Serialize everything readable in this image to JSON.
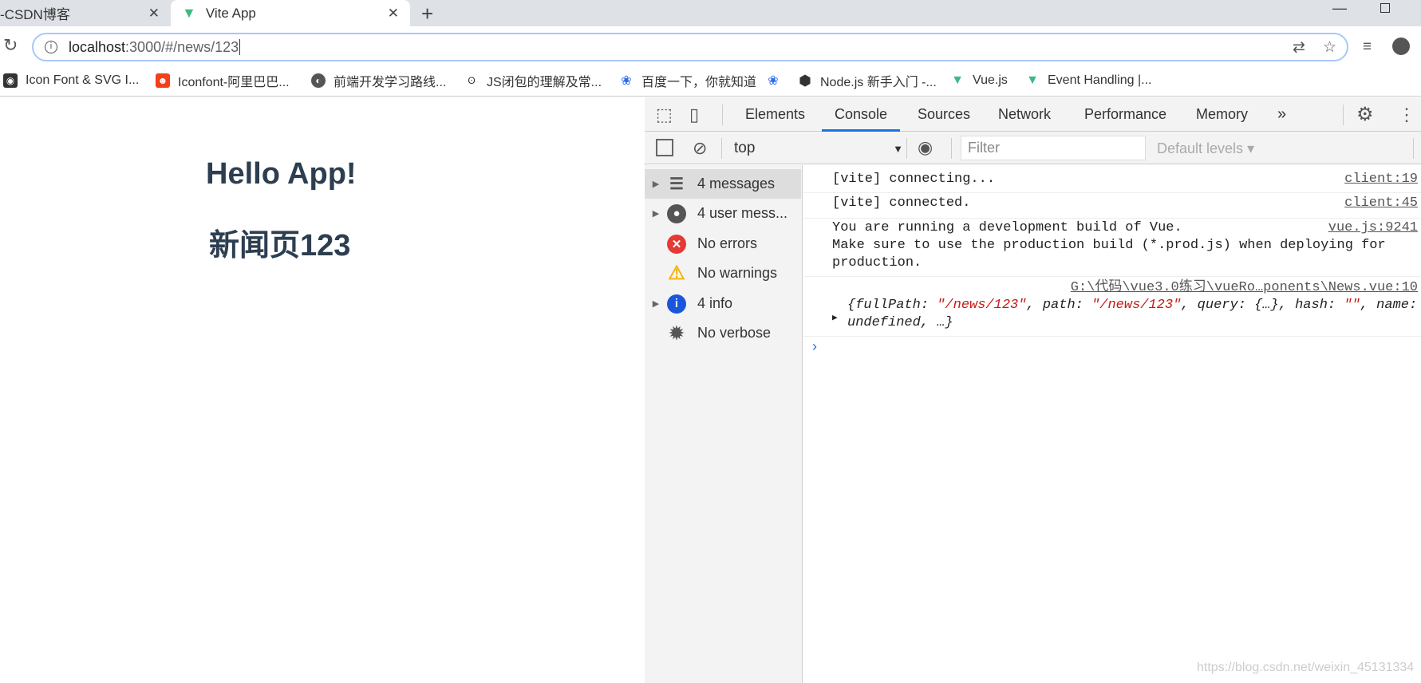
{
  "browser": {
    "tabs": [
      {
        "title": "-CSDN博客"
      },
      {
        "title": "Vite App",
        "active": true
      }
    ],
    "url_host": "localhost",
    "url_path": ":3000/#/news/123",
    "bookmarks": [
      {
        "label": "Icon Font & SVG I...",
        "icon": "iconfont-svg-icon",
        "color": "#333333"
      },
      {
        "label": "Iconfont-阿里巴巴...",
        "icon": "iconfont-alibaba-icon",
        "color": "#f1401b"
      },
      {
        "label": "前端开发学习路线...",
        "icon": "globe-icon",
        "color": "#555555"
      },
      {
        "label": "JS闭包的理解及常...",
        "icon": "js-closure-icon",
        "color": "#333333"
      },
      {
        "label": "百度一下，你就知道",
        "icon": "baidu-paw-icon",
        "color": "#2a6bf2"
      },
      {
        "label": "",
        "icon": "baidu-paw-icon",
        "color": "#2a6bf2"
      },
      {
        "label": "Node.js 新手入门 -...",
        "icon": "cnode-icon",
        "color": "#333333"
      },
      {
        "label": "Vue.js",
        "icon": "vue-logo-icon",
        "color": "#41b883"
      },
      {
        "label": "Event Handling |...",
        "icon": "vue-logo-icon",
        "color": "#41b883"
      }
    ]
  },
  "page": {
    "title": "Hello App!",
    "subtitle": "新闻页123"
  },
  "devtools": {
    "tabs": [
      "Elements",
      "Console",
      "Sources",
      "Network",
      "Performance",
      "Memory"
    ],
    "active_tab": "Console",
    "context": "top",
    "filter_placeholder": "Filter",
    "levels": "Default levels",
    "sidebar": [
      {
        "label": "4 messages",
        "icon": "list-icon",
        "expandable": true,
        "selected": true
      },
      {
        "label": "4 user mess...",
        "icon": "user-icon",
        "expandable": true
      },
      {
        "label": "No errors",
        "icon": "error-icon",
        "color": "#e53935"
      },
      {
        "label": "No warnings",
        "icon": "warning-icon",
        "color": "#f4b400"
      },
      {
        "label": "4 info",
        "icon": "info-icon",
        "expandable": true,
        "color": "#1a56db"
      },
      {
        "label": "No verbose",
        "icon": "bug-icon"
      }
    ],
    "messages": [
      {
        "text": "[vite] connecting...",
        "source": "client:19"
      },
      {
        "text": "[vite] connected.",
        "source": "client:45"
      },
      {
        "line1": "You are running a development build of Vue.",
        "line2": "Make sure to use the production build (*.prod.js) when deploying for",
        "line3": "production.",
        "source": "vue.js:9241"
      },
      {
        "source": "G:\\代码\\vue3.0练习\\vueRo…ponents\\News.vue:10",
        "p1": "{fullPath: ",
        "s1": "\"/news/123\"",
        "p2": ", path: ",
        "s2": "\"/news/123\"",
        "p3": ", query: {…}, hash: ",
        "s3": "\"\"",
        "p4": ", name:",
        "line2": "undefined, …}"
      }
    ]
  },
  "watermark": "https://blog.csdn.net/weixin_45131334"
}
